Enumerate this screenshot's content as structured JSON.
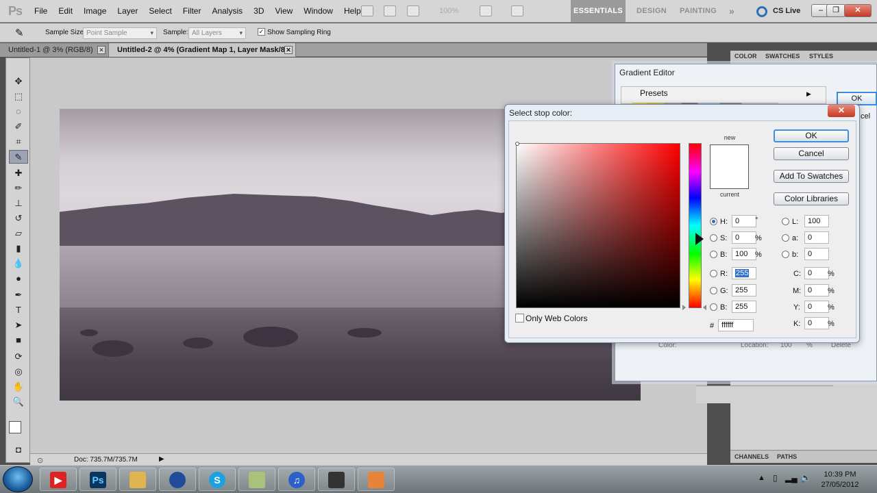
{
  "app": {
    "logo": "Ps"
  },
  "menu": [
    "File",
    "Edit",
    "Image",
    "Layer",
    "Select",
    "Filter",
    "Analysis",
    "3D",
    "View",
    "Window",
    "Help"
  ],
  "menubar": {
    "zoom": "100%",
    "workspaces": [
      "ESSENTIALS",
      "DESIGN",
      "PAINTING"
    ],
    "more": "»",
    "cslive": "CS Live"
  },
  "options": {
    "sample_size_label": "Sample Size:",
    "sample_size_value": "Point Sample",
    "sample_label": "Sample:",
    "sample_value": "All Layers",
    "show_ring_label": "Show Sampling Ring"
  },
  "tabs": [
    {
      "label": "Untitled-1 @ 3% (RGB/8)"
    },
    {
      "label": "Untitled-2 @ 4% (Gradient Map 1, Layer Mask/8) *"
    }
  ],
  "status": {
    "doc": "Doc: 735.7M/735.7M"
  },
  "dock": {
    "tabs": [
      "COLOR",
      "SWATCHES",
      "STYLES"
    ],
    "bottom_tabs": [
      "CHANNELS",
      "PATHS"
    ]
  },
  "gradient_editor": {
    "title": "Gradient Editor",
    "presets_label": "Presets",
    "ok": "OK",
    "cancel_frag": "cel",
    "bottom_color": "Color:",
    "bottom_location": "Location:",
    "bottom_loc_value": "100",
    "bottom_pct": "%",
    "bottom_delete": "Delete"
  },
  "stop_dialog": {
    "title": "Select stop color:",
    "new_label": "new",
    "current_label": "current",
    "buttons": {
      "ok": "OK",
      "cancel": "Cancel",
      "add": "Add To Swatches",
      "libraries": "Color Libraries"
    },
    "only_web": "Only Web Colors",
    "fields": {
      "H": {
        "label": "H:",
        "value": "0",
        "unit": "°",
        "selected": true
      },
      "S": {
        "label": "S:",
        "value": "0",
        "unit": "%"
      },
      "Bri": {
        "label": "B:",
        "value": "100",
        "unit": "%"
      },
      "R": {
        "label": "R:",
        "value": "255"
      },
      "G": {
        "label": "G:",
        "value": "255"
      },
      "Blu": {
        "label": "B:",
        "value": "255"
      },
      "L": {
        "label": "L:",
        "value": "100"
      },
      "a": {
        "label": "a:",
        "value": "0"
      },
      "b": {
        "label": "b:",
        "value": "0"
      },
      "C": {
        "label": "C:",
        "value": "0",
        "unit": "%"
      },
      "M": {
        "label": "M:",
        "value": "0",
        "unit": "%"
      },
      "Y": {
        "label": "Y:",
        "value": "0",
        "unit": "%"
      },
      "K": {
        "label": "K:",
        "value": "0",
        "unit": "%"
      }
    },
    "hex_label": "#",
    "hex_value": "ffffff",
    "new_color": "#ffffff",
    "current_color": "#ffffff"
  },
  "taskbar": {
    "clock_time": "10:39 PM",
    "clock_date": "27/05/2012"
  }
}
